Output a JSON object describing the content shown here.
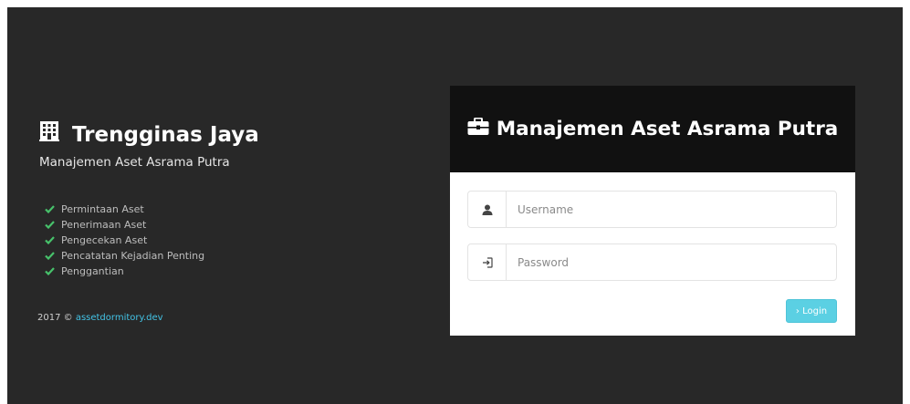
{
  "brand": {
    "title": "Trengginas Jaya",
    "subtitle": "Manajemen Aset Asrama Putra",
    "icon": "building-icon"
  },
  "features": [
    {
      "label": "Permintaan Aset",
      "icon": "check-icon"
    },
    {
      "label": "Penerimaan Aset",
      "icon": "check-icon"
    },
    {
      "label": "Pengecekan Aset",
      "icon": "check-icon"
    },
    {
      "label": "Pencatatan Kejadian Penting",
      "icon": "check-icon"
    },
    {
      "label": "Penggantian",
      "icon": "check-icon"
    }
  ],
  "footer": {
    "text": "2017 © ",
    "link": "assetdormitory.dev"
  },
  "login": {
    "title": "Manajemen Aset Asrama Putra",
    "title_icon": "briefcase-icon",
    "username": {
      "placeholder": "Username",
      "value": "",
      "icon": "user-icon"
    },
    "password": {
      "placeholder": "Password",
      "value": "",
      "icon": "sign-in-icon"
    },
    "button_label": "› Login"
  },
  "colors": {
    "background": "#282828",
    "card_header": "#111111",
    "check": "#47c26b",
    "link": "#43c3e6",
    "button": "#5bd0e3"
  }
}
